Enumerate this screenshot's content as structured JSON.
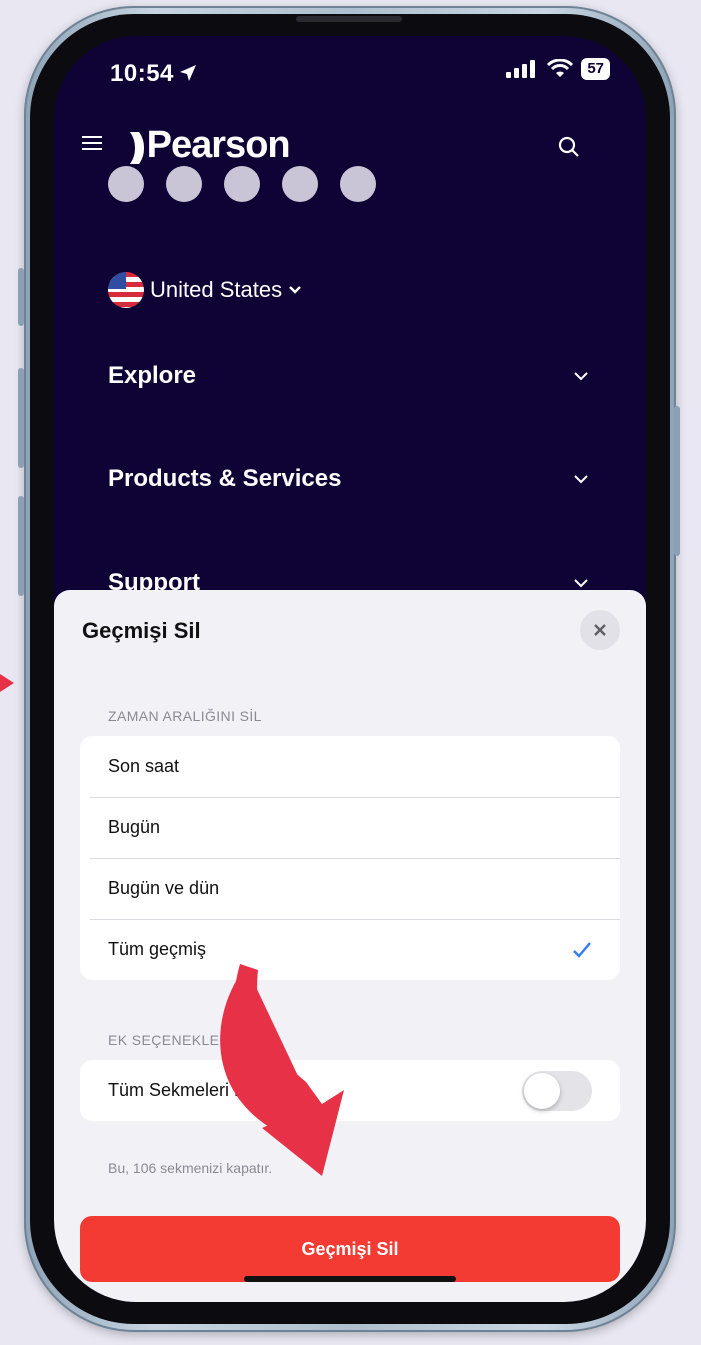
{
  "status_bar": {
    "time": "10:54",
    "battery": "57"
  },
  "header": {
    "logo_text": "Pearson",
    "logo_mark": "))"
  },
  "site_nav": {
    "country": "United States",
    "items": [
      {
        "label": "Explore"
      },
      {
        "label": "Products & Services"
      },
      {
        "label": "Support"
      }
    ]
  },
  "sheet": {
    "title": "Geçmişi Sil",
    "section_range_label": "ZAMAN ARALIĞINI SİL",
    "range_options": [
      {
        "label": "Son saat"
      },
      {
        "label": "Bugün"
      },
      {
        "label": "Bugün ve dün"
      },
      {
        "label": "Tüm geçmiş",
        "selected": true
      }
    ],
    "section_extra_label": "EK SEÇENEKLER",
    "close_tabs_label": "Tüm Sekmeleri Kapat",
    "close_tabs_on": false,
    "close_tabs_note": "Bu, 106 sekmenizi kapatır.",
    "confirm_button": "Geçmişi Sil"
  },
  "colors": {
    "site_bg": "#0f0336",
    "danger": "#f33a33",
    "accent_check": "#2f7bf6",
    "annotation_arrow": "#e63146"
  }
}
